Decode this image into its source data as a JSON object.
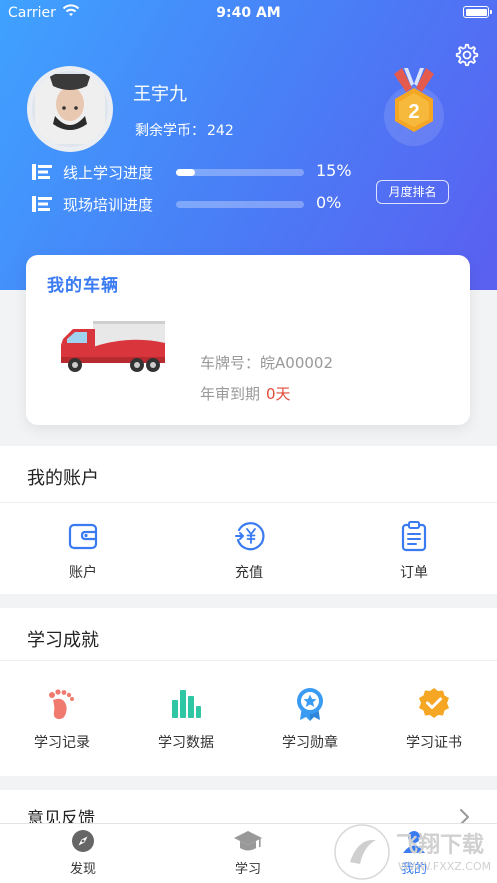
{
  "status_bar": {
    "carrier": "Carrier",
    "time": "9:40 AM"
  },
  "profile": {
    "name": "王宇九",
    "coins_label": "剩余学币：",
    "coins_value": "242",
    "medal_rank": "2"
  },
  "progress": [
    {
      "label": "线上学习进度",
      "percent_text": "15%",
      "percent": 15
    },
    {
      "label": "现场培训进度",
      "percent_text": "0%",
      "percent": 0
    }
  ],
  "monthly_rank_button": "月度排名",
  "vehicle_card": {
    "title": "我的车辆",
    "plate_label": "车牌号：",
    "plate_value": "皖A00002",
    "annual_label": "年审到期",
    "annual_value": "0天"
  },
  "account_section": {
    "title": "我的账户",
    "items": [
      {
        "label": "账户",
        "icon": "wallet-icon"
      },
      {
        "label": "充值",
        "icon": "recharge-icon"
      },
      {
        "label": "订单",
        "icon": "clipboard-icon"
      }
    ]
  },
  "achievement_section": {
    "title": "学习成就",
    "items": [
      {
        "label": "学习记录",
        "icon": "footprint-icon"
      },
      {
        "label": "学习数据",
        "icon": "bar-chart-icon"
      },
      {
        "label": "学习勋章",
        "icon": "medal-icon"
      },
      {
        "label": "学习证书",
        "icon": "certificate-icon"
      }
    ]
  },
  "feedback": {
    "title": "意见反馈"
  },
  "tabbar": {
    "items": [
      {
        "label": "发现",
        "icon": "compass-icon"
      },
      {
        "label": "学习",
        "icon": "graduation-cap-icon"
      },
      {
        "label": "我的",
        "icon": "user-icon"
      }
    ]
  },
  "watermark": {
    "text": "飞翔下载",
    "url": "WWW.FXXZ.COM"
  },
  "colors": {
    "accent": "#3a7bf2",
    "header_start": "#3fa2ff",
    "header_end": "#5b5ff0",
    "alert": "#e24b3b",
    "medal_gold": "#f5a623"
  }
}
